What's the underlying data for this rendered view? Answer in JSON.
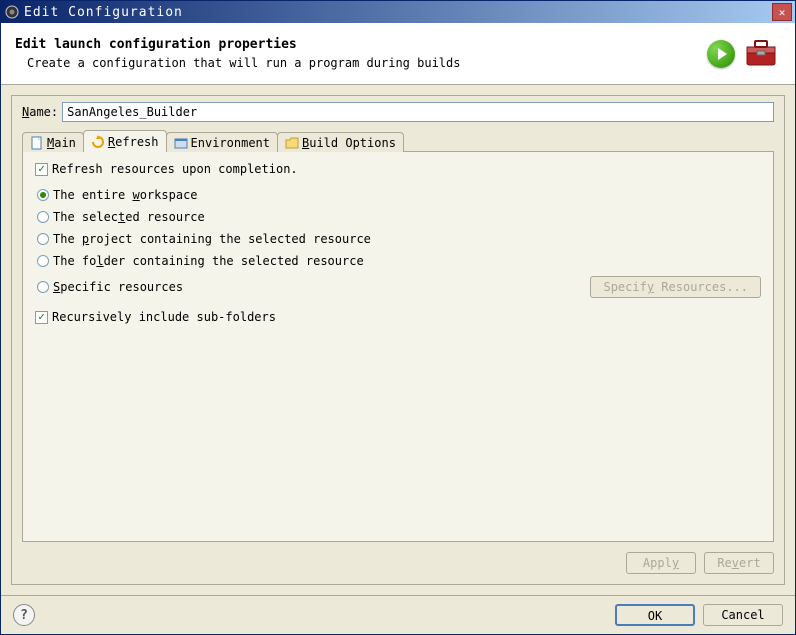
{
  "window": {
    "title": "Edit Configuration"
  },
  "header": {
    "title": "Edit launch configuration properties",
    "description": "Create a configuration that will run a program during builds"
  },
  "name": {
    "label": "Name:",
    "value": "SanAngeles_Builder"
  },
  "tabs": {
    "main": "Main",
    "refresh": "Refresh",
    "environment": "Environment",
    "build_options": "Build Options"
  },
  "refresh_tab": {
    "refresh_on_completion": "Refresh resources upon completion.",
    "radio_workspace": "The entire workspace",
    "radio_selected": "The selected resource",
    "radio_project": "The project containing the selected resource",
    "radio_folder": "The folder containing the selected resource",
    "radio_specific": "Specific resources",
    "specify_btn": "Specify Resources...",
    "recursive": "Recursively include sub-folders"
  },
  "buttons": {
    "apply": "Apply",
    "revert": "Revert",
    "ok": "OK",
    "cancel": "Cancel"
  }
}
